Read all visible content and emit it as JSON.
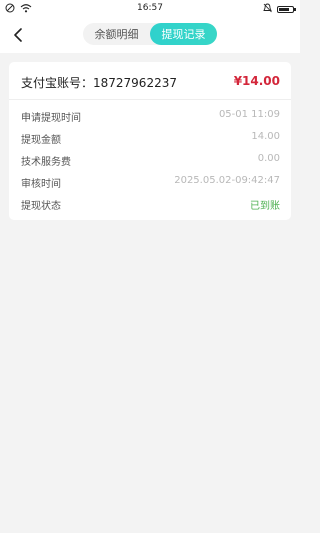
{
  "status_bar": {
    "time": "16:57",
    "battery_level": 0.8
  },
  "header": {
    "tabs": [
      {
        "label": "余额明细",
        "active": false
      },
      {
        "label": "提现记录",
        "active": true
      }
    ]
  },
  "record": {
    "account_label": "支付宝账号：18727962237",
    "amount": "¥14.00",
    "rows": [
      {
        "label": "申请提现时间",
        "value": "05-01 11:09"
      },
      {
        "label": "提现金额",
        "value": "14.00"
      },
      {
        "label": "技术服务费",
        "value": "0.00"
      },
      {
        "label": "审核时间",
        "value": "2025.05.02-09:42:47"
      },
      {
        "label": "提现状态",
        "value": "已到账"
      }
    ]
  },
  "colors": {
    "accent": "#2fd1cc",
    "amount": "#d3263a",
    "success": "#4caf50"
  }
}
